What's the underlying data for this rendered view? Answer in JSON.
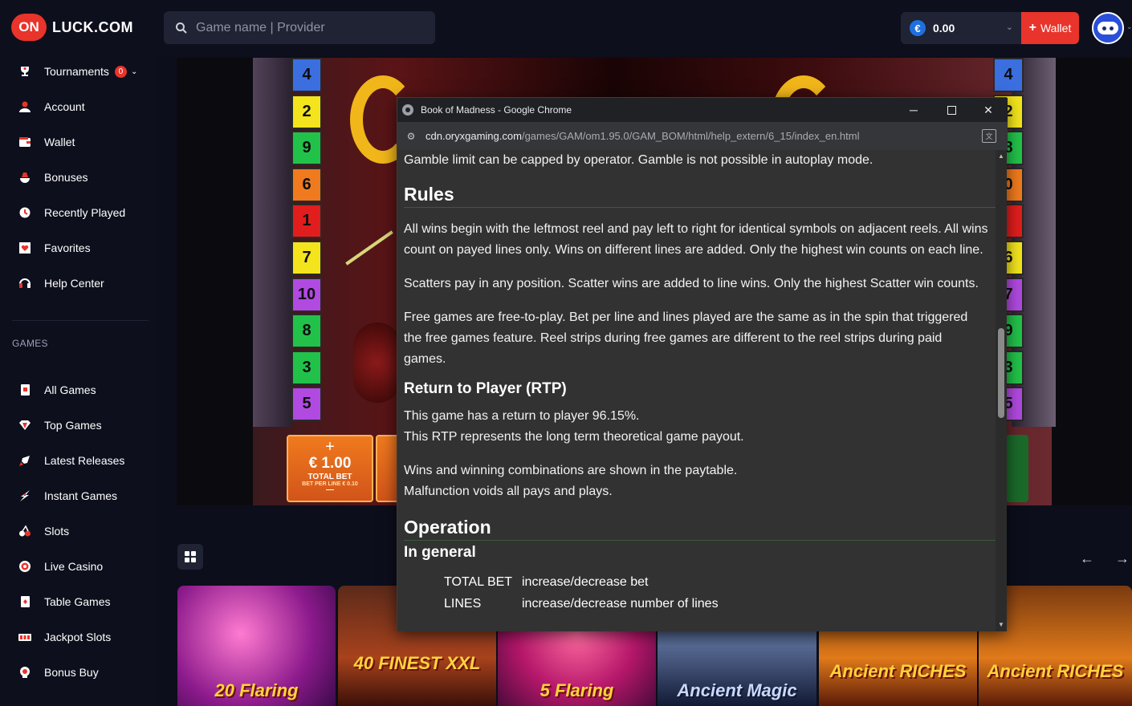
{
  "header": {
    "logo_badge": "ON",
    "logo_text": "LUCK.COM",
    "search_placeholder": "Game name | Provider",
    "balance_currency": "€",
    "balance_value": "0.00",
    "wallet_label": "Wallet"
  },
  "sidebar": {
    "items": [
      {
        "label": "Tournaments",
        "badge": "0"
      },
      {
        "label": "Account"
      },
      {
        "label": "Wallet"
      },
      {
        "label": "Bonuses"
      },
      {
        "label": "Recently Played"
      },
      {
        "label": "Favorites"
      },
      {
        "label": "Help Center"
      }
    ],
    "games_heading": "GAMES",
    "games": [
      {
        "label": "All Games"
      },
      {
        "label": "Top Games"
      },
      {
        "label": "Latest Releases"
      },
      {
        "label": "Instant Games"
      },
      {
        "label": "Slots"
      },
      {
        "label": "Live Casino"
      },
      {
        "label": "Table Games"
      },
      {
        "label": "Jackpot Slots"
      },
      {
        "label": "Bonus Buy"
      }
    ]
  },
  "game": {
    "line_numbers_left": [
      "4",
      "2",
      "9",
      "6",
      "1",
      "7",
      "10",
      "8",
      "3",
      "5"
    ],
    "line_numbers_right": [
      "4",
      "2",
      "8",
      "0",
      "",
      "6",
      "7",
      "9",
      "3",
      "5"
    ],
    "line_colors": [
      "#3b6fe0",
      "#f3e41d",
      "#22c24a",
      "#f07a1e",
      "#e21d1d",
      "#f3e41d",
      "#b14ae0",
      "#22c24a",
      "#22c24a",
      "#b14ae0"
    ],
    "bet_plus": "+",
    "bet_value": "€ 1.00",
    "bet_label": "TOTAL BET",
    "bet_sub": "BET PER LINE € 0.10",
    "bet_minus": "—"
  },
  "lobby": {
    "tiles": [
      {
        "title": "20 Flaring"
      },
      {
        "title": "40 FINEST XXL"
      },
      {
        "title": "5 Flaring"
      },
      {
        "title": "Ancient Magic"
      },
      {
        "title": "Ancient RICHES"
      },
      {
        "title": "Ancient RICHES"
      }
    ]
  },
  "popup": {
    "window_title": "Book of Madness - Google Chrome",
    "url_host": "cdn.oryxgaming.com",
    "url_path": "/games/GAM/om1.95.0/GAM_BOM/html/help_extern/6_15/index_en.html",
    "line_gamble": "Gamble limit can be capped by operator. Gamble is not possible in autoplay mode.",
    "rules_heading": "Rules",
    "rules_p1": "All wins begin with the leftmost reel and pay left to right for identical symbols on adjacent reels. All wins count on payed lines only. Wins on different lines are added. Only the highest win counts on each line.",
    "rules_p2": "Scatters pay in any position. Scatter wins are added to line wins. Only the highest Scatter win counts.",
    "rules_p3": "Free games are free-to-play. Bet per line and lines played are the same as in the spin that triggered the free games feature. Reel strips during free games are different to the reel strips during paid games.",
    "rtp_heading": "Return to Player (RTP)",
    "rtp_p1": "This game has a return to player 96.15%.",
    "rtp_p2": "This RTP represents the long term theoretical game payout.",
    "rtp_p3": "Wins and winning combinations are shown in the paytable.",
    "rtp_p4": "Malfunction voids all pays and plays.",
    "operation_heading": "Operation",
    "general_heading": "In general",
    "op_rows": [
      {
        "key": "TOTAL BET",
        "value": "increase/decrease bet"
      },
      {
        "key": "LINES",
        "value": "increase/decrease number of lines"
      }
    ]
  }
}
